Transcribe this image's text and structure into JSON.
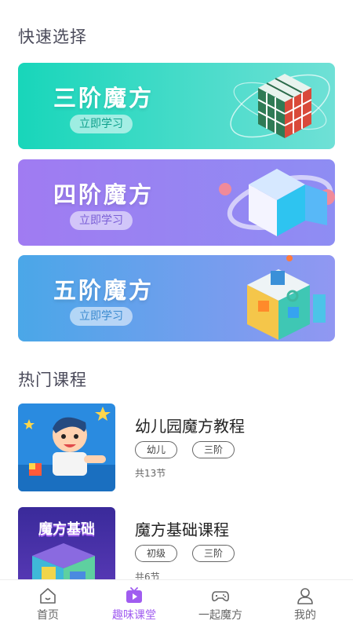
{
  "sections": {
    "quick_select": "快速选择",
    "hot_courses": "热门课程"
  },
  "banners": [
    {
      "title": "三阶魔方",
      "button": "立即学习"
    },
    {
      "title": "四阶魔方",
      "button": "立即学习"
    },
    {
      "title": "五阶魔方",
      "button": "立即学习"
    }
  ],
  "courses": [
    {
      "title": "幼儿园魔方教程",
      "tags": [
        "幼儿",
        "三阶"
      ],
      "count": "共13节"
    },
    {
      "title": "魔方基础课程",
      "tags": [
        "初级",
        "三阶"
      ],
      "count": "共6节",
      "thumb_text": "魔方基础"
    }
  ],
  "tabbar": {
    "items": [
      {
        "label": "首页",
        "icon": "home-icon"
      },
      {
        "label": "趣味课堂",
        "icon": "tv-play-icon"
      },
      {
        "label": "一起魔方",
        "icon": "gamepad-icon"
      },
      {
        "label": "我的",
        "icon": "person-icon"
      }
    ],
    "active": 1,
    "active_color": "#a05cf0"
  }
}
